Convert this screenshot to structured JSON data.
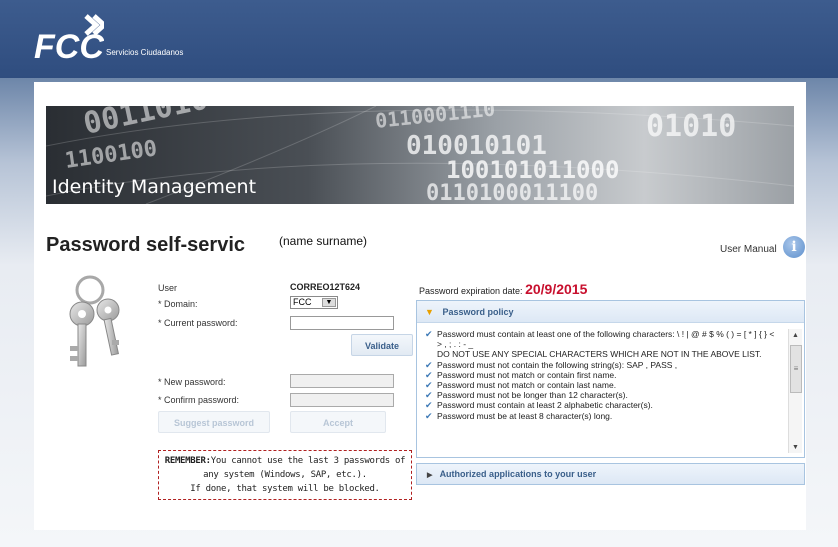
{
  "header": {
    "logo_text": "FCC",
    "logo_subtitle": "Servicios Ciudadanos"
  },
  "banner": {
    "title": "Identity Management"
  },
  "page": {
    "title": "Password self-servic",
    "name_overlay": "(name surname)",
    "user_manual_label": "User Manual",
    "info_glyph": "i"
  },
  "form": {
    "user_label": "User",
    "user_value": "CORREO12T624",
    "domain_label": "* Domain:",
    "domain_value": "FCC",
    "current_password_label": "* Current password:",
    "validate_label": "Validate",
    "new_password_label": "* New password:",
    "confirm_password_label": "* Confirm password:",
    "suggest_label": "Suggest password",
    "accept_label": "Accept"
  },
  "remember": {
    "prefix": "REMEMBER:",
    "line1": "You cannot use the last 3 passwords of",
    "line2": "any system (Windows, SAP, etc.).",
    "line3": "If done, that system will be blocked."
  },
  "expiry": {
    "label": "Password expiration date:",
    "date": "20/9/2015"
  },
  "policy": {
    "title": "Password policy",
    "rules": [
      {
        "check": true,
        "text": "Password must contain at least one of the following characters: \\ ! | @ # $ % ( ) = [ * ] { } < > , ; . : - _"
      },
      {
        "check": false,
        "text": "DO NOT USE ANY SPECIAL CHARACTERS WHICH ARE NOT IN THE ABOVE LIST."
      },
      {
        "check": true,
        "text": "Password must not contain the following string(s): SAP , PASS ,"
      },
      {
        "check": true,
        "text": "Password must not match or contain first name."
      },
      {
        "check": true,
        "text": "Password must not match or contain last name."
      },
      {
        "check": true,
        "text": "Password must not be longer than 12 character(s)."
      },
      {
        "check": true,
        "text": "Password must contain at least 2 alphabetic character(s)."
      },
      {
        "check": true,
        "text": "Password must be at least 8 character(s) long."
      }
    ]
  },
  "authorized": {
    "title": "Authorized applications to your user"
  },
  "colors": {
    "header_bg": "#2f4d7f",
    "accent_blue": "#3a5f8a",
    "expiry_red": "#c8102e",
    "remember_border": "#b02020"
  }
}
